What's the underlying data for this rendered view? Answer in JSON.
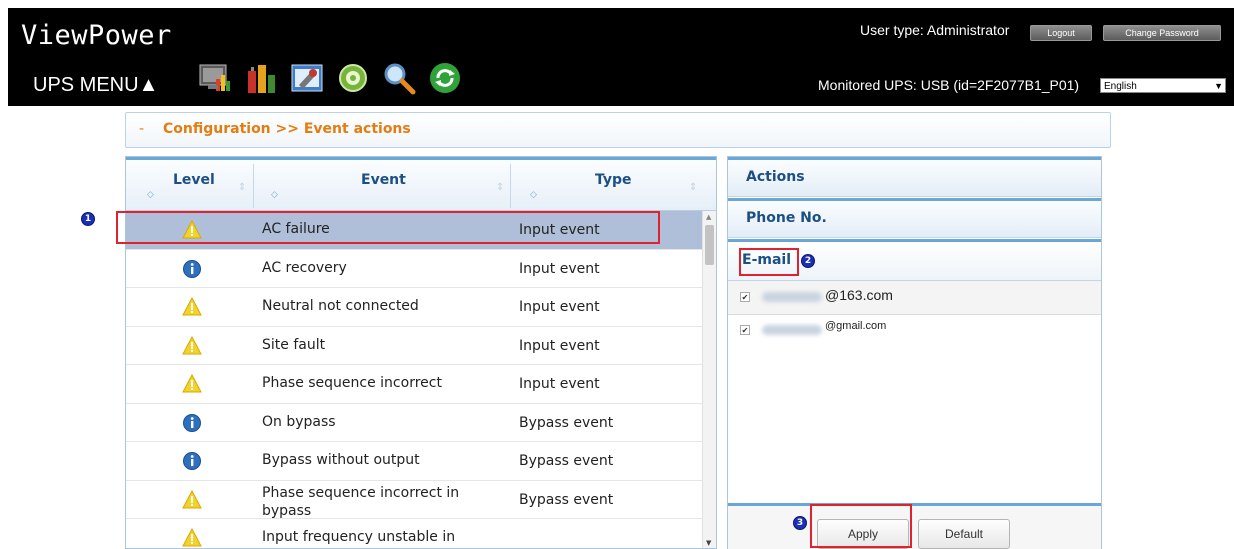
{
  "header": {
    "title": "ViewPower",
    "menu_label": "UPS MENU▲",
    "user_type": "User type: Administrator",
    "logout_label": "Logout",
    "change_password_label": "Change Password",
    "monitored_ups": "Monitored UPS: USB (id=2F2077B1_P01)",
    "language_selected": "English",
    "toolbar_icons": [
      "monitor-icon",
      "battery-chart-icon",
      "settings-tools-icon",
      "gear-icon",
      "search-icon",
      "refresh-icon"
    ]
  },
  "breadcrumb": {
    "text": "Configuration >> Event actions"
  },
  "event_table": {
    "columns": [
      "Level",
      "Event",
      "Type"
    ],
    "rows": [
      {
        "level": "warning",
        "event": "AC failure",
        "type": "Input event",
        "selected": true
      },
      {
        "level": "info",
        "event": "AC recovery",
        "type": "Input event"
      },
      {
        "level": "warning",
        "event": "Neutral not connected",
        "type": "Input event"
      },
      {
        "level": "warning",
        "event": "Site fault",
        "type": "Input event"
      },
      {
        "level": "warning",
        "event": "Phase sequence incorrect",
        "type": "Input event"
      },
      {
        "level": "info",
        "event": "On bypass",
        "type": "Bypass event"
      },
      {
        "level": "info",
        "event": "Bypass without output",
        "type": "Bypass event"
      },
      {
        "level": "warning",
        "event": "Phase sequence incorrect in bypass",
        "type": "Bypass event"
      },
      {
        "level": "warning",
        "event": "Input frequency unstable in",
        "type": ""
      }
    ]
  },
  "actions": {
    "title": "Actions",
    "phone_label": "Phone No.",
    "email_label": "E-mail",
    "emails": [
      {
        "suffix": "@163.com",
        "checked": true
      },
      {
        "suffix": "@gmail.com",
        "checked": true
      }
    ],
    "apply_label": "Apply",
    "default_label": "Default"
  },
  "annotations": {
    "marker_1": "1",
    "marker_2": "2",
    "marker_3": "3"
  },
  "colors": {
    "accent_orange": "#e57c10",
    "header_blue": "#1b4f86",
    "highlight_red": "#e0212e",
    "selected_row": "#afbfd9"
  }
}
